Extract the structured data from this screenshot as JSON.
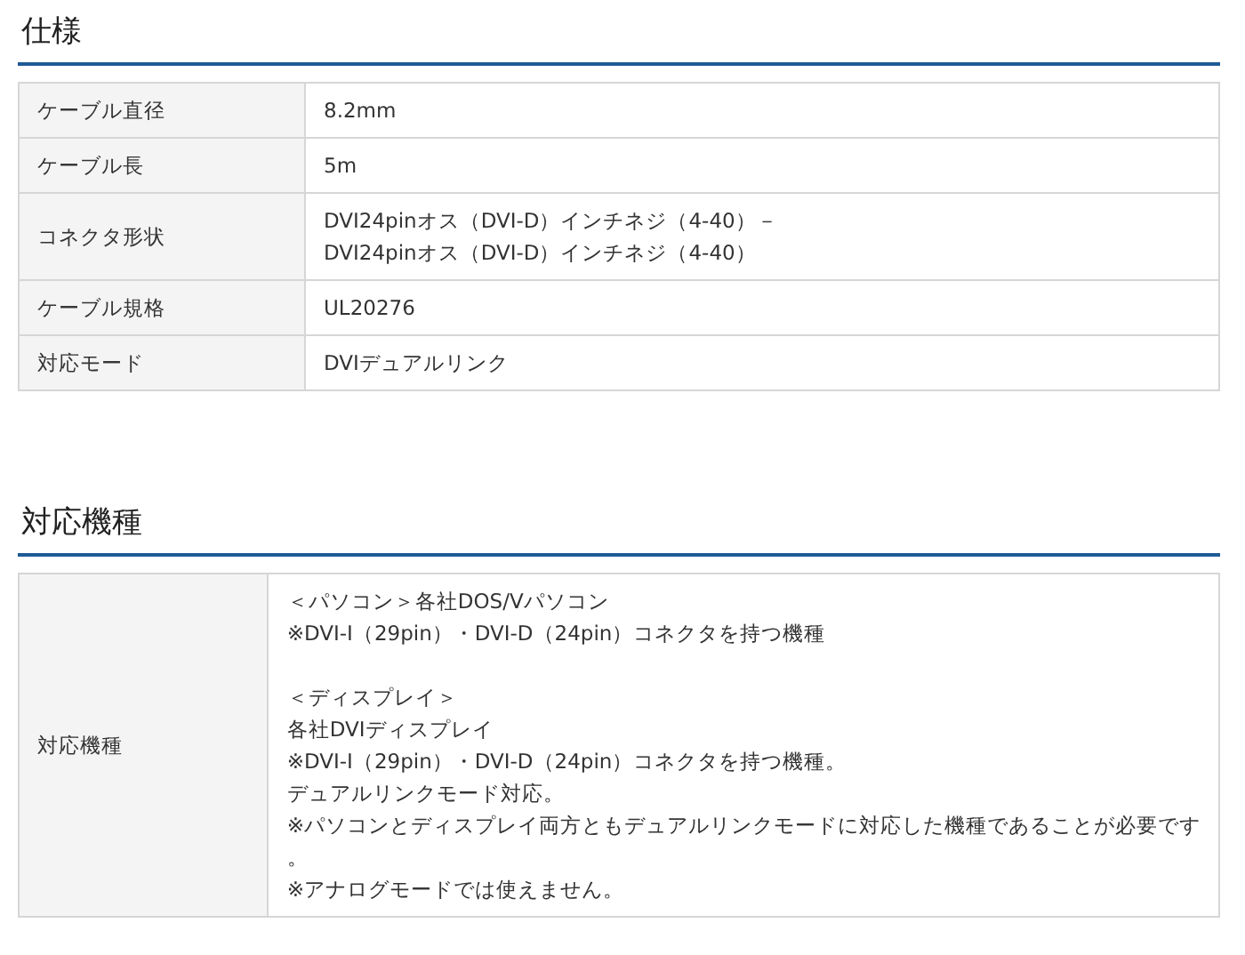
{
  "sections": [
    {
      "title": "仕様",
      "rows": [
        {
          "label": "ケーブル直径",
          "paragraphs": [
            [
              "8.2mm"
            ]
          ]
        },
        {
          "label": "ケーブル長",
          "paragraphs": [
            [
              "5m"
            ]
          ]
        },
        {
          "label": "コネクタ形状",
          "paragraphs": [
            [
              "DVI24pinオス（DVI-D）インチネジ（4-40）－",
              "DVI24pinオス（DVI-D）インチネジ（4-40）"
            ]
          ]
        },
        {
          "label": "ケーブル規格",
          "paragraphs": [
            [
              "UL20276"
            ]
          ]
        },
        {
          "label": "対応モード",
          "paragraphs": [
            [
              "DVIデュアルリンク"
            ]
          ]
        }
      ]
    },
    {
      "title": "対応機種",
      "rows": [
        {
          "label": "対応機種",
          "paragraphs": [
            [
              "＜パソコン＞各社DOS/Vパソコン",
              "※DVI-I（29pin）・DVI-D（24pin）コネクタを持つ機種"
            ],
            [
              "＜ディスプレイ＞",
              "各社DVIディスプレイ",
              "※DVI-I（29pin）・DVI-D（24pin）コネクタを持つ機種。",
              "デュアルリンクモード対応。",
              "※パソコンとディスプレイ両方ともデュアルリンクモードに対応した機種であることが必要です",
              "。",
              "※アナログモードでは使えません。"
            ]
          ]
        }
      ]
    }
  ]
}
